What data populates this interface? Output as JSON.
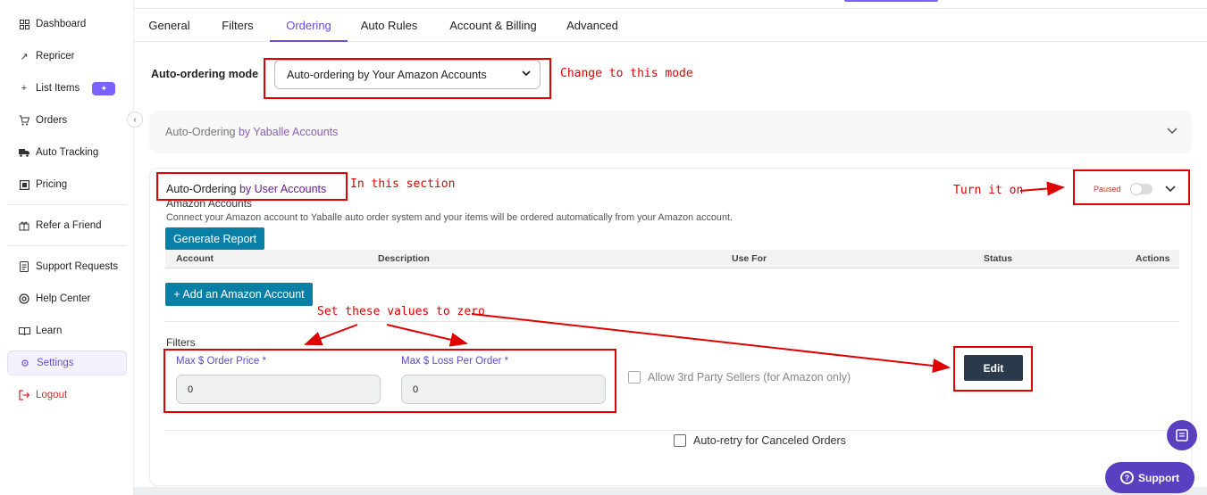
{
  "sidebar": {
    "items": [
      {
        "label": "Dashboard",
        "icon": "grid-icon"
      },
      {
        "label": "Repricer",
        "icon": "trend-icon"
      },
      {
        "label": "List Items",
        "icon": "plus-icon",
        "badge": "new"
      },
      {
        "label": "Orders",
        "icon": "cart-icon"
      },
      {
        "label": "Auto Tracking",
        "icon": "truck-icon"
      },
      {
        "label": "Pricing",
        "icon": "tag-icon"
      },
      {
        "label": "Refer a Friend",
        "icon": "gift-icon"
      },
      {
        "label": "Support Requests",
        "icon": "doc-icon"
      },
      {
        "label": "Help Center",
        "icon": "lifebuoy-icon"
      },
      {
        "label": "Learn",
        "icon": "book-icon"
      },
      {
        "label": "Settings",
        "icon": "gear-icon",
        "active": true
      },
      {
        "label": "Logout",
        "icon": "logout-icon"
      }
    ]
  },
  "tabs": [
    "General",
    "Filters",
    "Ordering",
    "Auto Rules",
    "Account & Billing",
    "Advanced"
  ],
  "active_tab": "Ordering",
  "ordering": {
    "mode_label": "Auto-ordering mode",
    "mode_value": "Auto-ordering by Your Amazon Accounts",
    "section1": {
      "prefix": "Auto-Ordering ",
      "highlight": "by Yaballe Accounts"
    },
    "section2": {
      "prefix": "Auto-Ordering ",
      "highlight": "by User Accounts",
      "status": "Paused",
      "accounts_heading": "Amazon Accounts",
      "description": "Connect your Amazon account to Yaballe auto order system and your items will be ordered automatically from your Amazon account.",
      "generate_report": "Generate Report",
      "table_headers": [
        "Account",
        "Description",
        "Use For",
        "Status",
        "Actions"
      ],
      "add_account": "+ Add an Amazon Account",
      "filters_label": "Filters",
      "max_order_price_label": "Max $ Order Price *",
      "max_order_price_value": "0",
      "max_loss_label": "Max $ Loss Per Order *",
      "max_loss_value": "0",
      "allow_3rd_party": "Allow 3rd Party Sellers (for Amazon only)",
      "edit": "Edit",
      "auto_retry": "Auto-retry for Canceled Orders"
    }
  },
  "annotations": {
    "change_mode": "Change to this mode",
    "in_section": "In this section",
    "turn_on": "Turn it on",
    "set_zero": "Set these values to zero"
  },
  "support_label": "Support",
  "colors": {
    "accent": "#6a4fd8",
    "annotation": "#e00000",
    "teal": "#0a7fa6",
    "dark_button": "#2b3a4a"
  }
}
